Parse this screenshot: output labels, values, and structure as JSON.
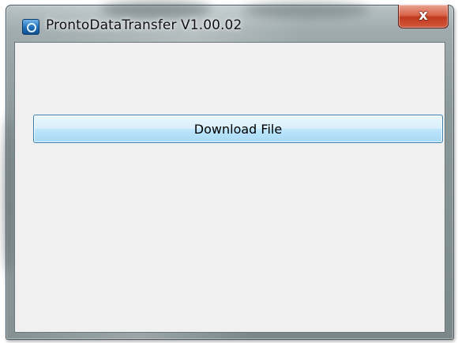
{
  "window": {
    "title": "ProntoDataTransfer V1.00.02",
    "icon": "app-icon",
    "close_icon": "close-icon",
    "close_glyph": "x",
    "accent": "#c03a1f"
  },
  "main": {
    "download_button_label": "Download File",
    "button_color": "#bee6fd"
  }
}
